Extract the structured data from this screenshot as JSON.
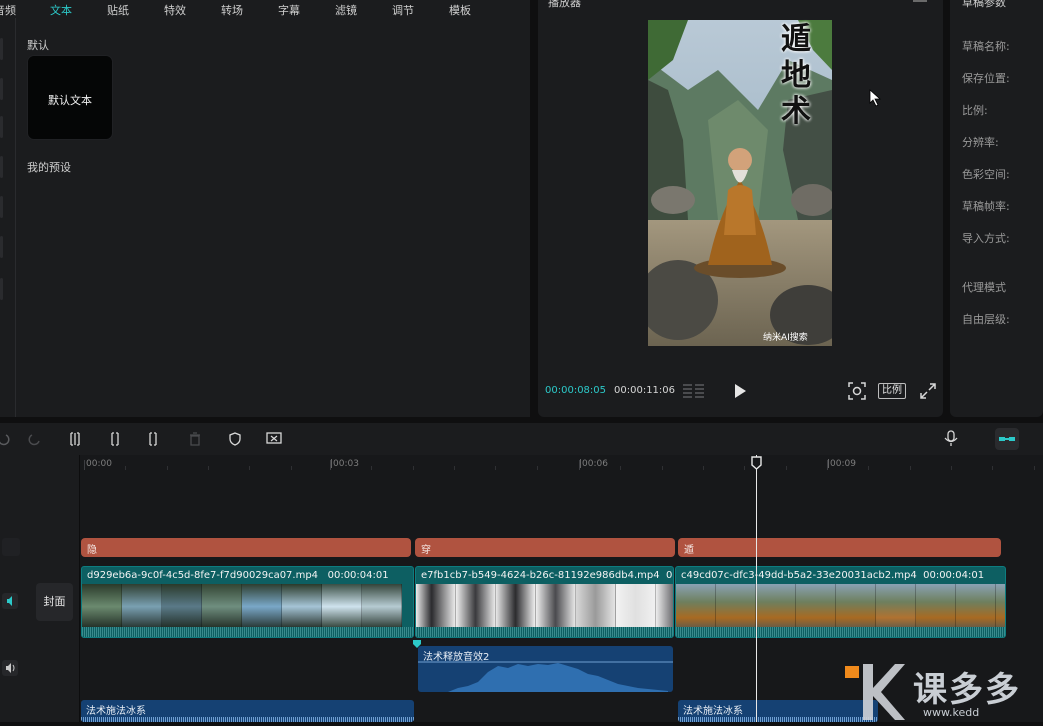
{
  "media_tabs": [
    {
      "label": "音频",
      "active": false
    },
    {
      "label": "文本",
      "active": true
    },
    {
      "label": "贴纸",
      "active": false
    },
    {
      "label": "特效",
      "active": false
    },
    {
      "label": "转场",
      "active": false
    },
    {
      "label": "字幕",
      "active": false
    },
    {
      "label": "滤镜",
      "active": false
    },
    {
      "label": "调节",
      "active": false
    },
    {
      "label": "模板",
      "active": false
    }
  ],
  "text_panel": {
    "default_section": "默认",
    "default_card": "默认文本",
    "my_presets": "我的预设"
  },
  "player": {
    "title": "播放器",
    "video_title": "遁地术",
    "watermark": "纳米AI搜索",
    "time_current": "00:00:08:05",
    "time_total": "00:00:11:06",
    "ratio_label": "比例"
  },
  "props_panel": {
    "title": "草稿参数",
    "fields": [
      "草稿名称:",
      "保存位置:",
      "比例:",
      "分辨率:",
      "色彩空间:",
      "草稿帧率:",
      "导入方式:",
      "代理模式",
      "自由层级:"
    ]
  },
  "timeline": {
    "ruler_labels": [
      "00:00",
      "|00:03",
      "|00:06",
      "|00:09"
    ],
    "cover_label": "封面",
    "text_clips": [
      "隐",
      "穿",
      "遁"
    ],
    "video_clips": [
      {
        "name": "d929eb6a-9c0f-4c5d-8fe7-f7d90029ca07.mp4",
        "duration": "00:00:04:01"
      },
      {
        "name": "e7fb1cb7-b549-4624-b26c-81192e986db4.mp4",
        "duration": "00:0"
      },
      {
        "name": "c49cd07c-dfc3-49dd-b5a2-33e20031acb2.mp4",
        "duration": "00:00:04:01"
      }
    ],
    "audio_clips": [
      {
        "name": "法术释放音效2"
      },
      {
        "name": "法术施法冰系"
      },
      {
        "name": "法术施法冰系"
      }
    ]
  },
  "logo_text": "课多多",
  "logo_sub": "www.kedd",
  "colors": {
    "accent": "#2cc9c9",
    "text_clip": "#b05340",
    "video_clip": "#0d5f62",
    "audio_clip": "#154173"
  }
}
